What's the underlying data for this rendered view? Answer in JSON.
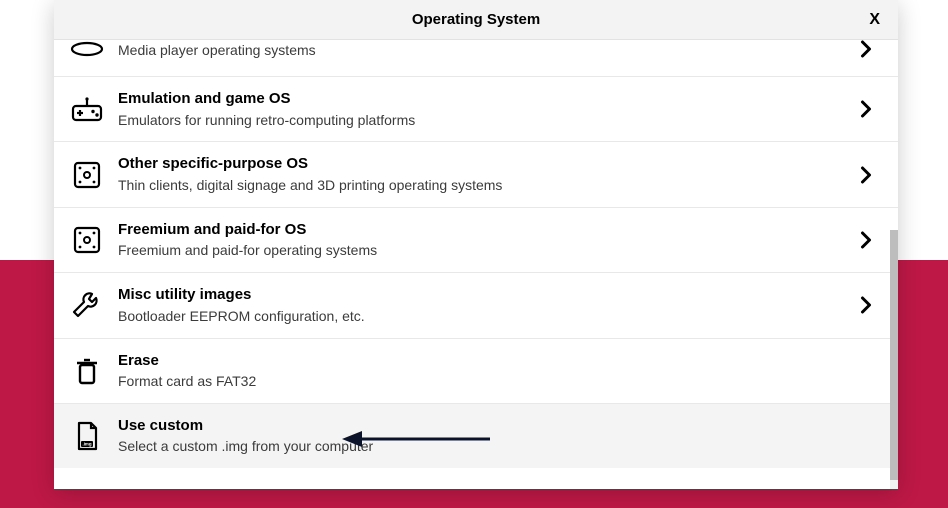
{
  "header": {
    "title": "Operating System",
    "close_label": "X"
  },
  "partial_row": {
    "desc": "Media player operating systems"
  },
  "rows": [
    {
      "icon": "gamepad",
      "title": "Emulation and game OS",
      "desc": "Emulators for running retro-computing platforms",
      "chevron": true
    },
    {
      "icon": "die",
      "title": "Other specific-purpose OS",
      "desc": "Thin clients, digital signage and 3D printing operating systems",
      "chevron": true
    },
    {
      "icon": "die",
      "title": "Freemium and paid-for OS",
      "desc": "Freemium and paid-for operating systems",
      "chevron": true
    },
    {
      "icon": "wrench",
      "title": "Misc utility images",
      "desc": "Bootloader EEPROM configuration, etc.",
      "chevron": true
    },
    {
      "icon": "trash",
      "title": "Erase",
      "desc": "Format card as FAT32",
      "chevron": false
    },
    {
      "icon": "imgfile",
      "title": "Use custom",
      "desc": "Select a custom .img from your computer",
      "chevron": false,
      "highlight": true
    }
  ]
}
